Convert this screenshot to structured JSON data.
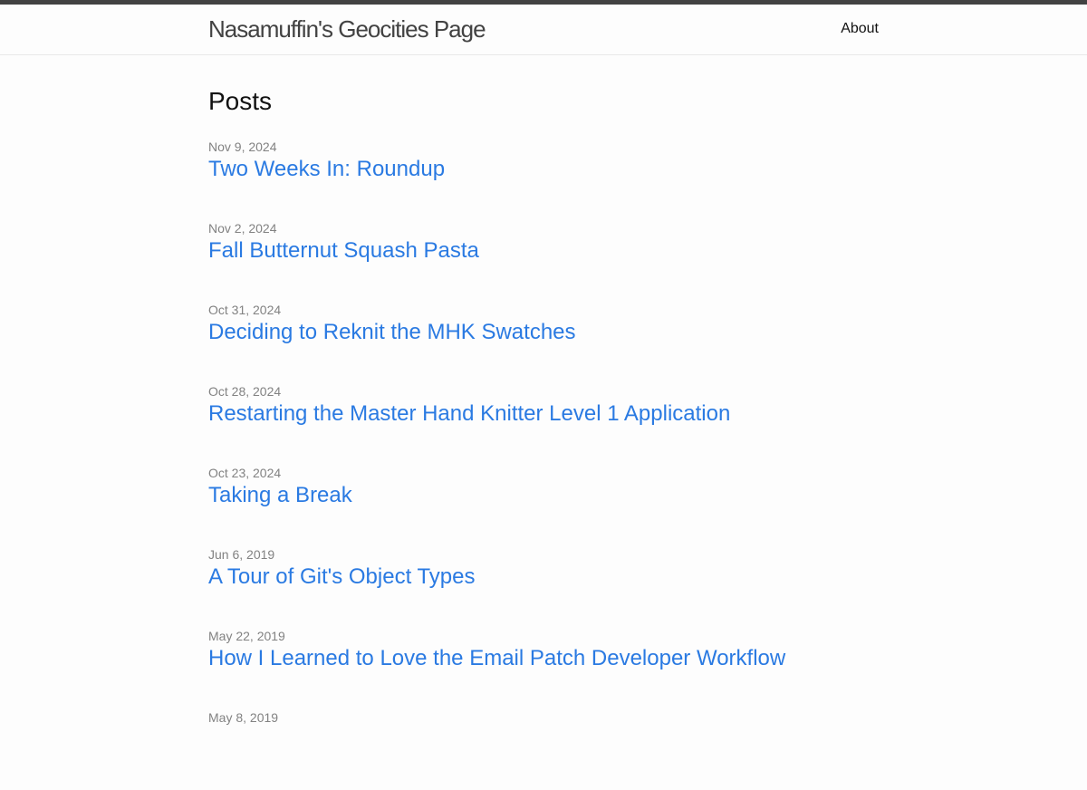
{
  "header": {
    "site_title": "Nasamuffin's Geocities Page",
    "nav": [
      {
        "label": "About"
      }
    ]
  },
  "main": {
    "heading": "Posts",
    "posts": [
      {
        "date": "Nov 9, 2024",
        "title": "Two Weeks In: Roundup"
      },
      {
        "date": "Nov 2, 2024",
        "title": "Fall Butternut Squash Pasta"
      },
      {
        "date": "Oct 31, 2024",
        "title": "Deciding to Reknit the MHK Swatches"
      },
      {
        "date": "Oct 28, 2024",
        "title": "Restarting the Master Hand Knitter Level 1 Application"
      },
      {
        "date": "Oct 23, 2024",
        "title": "Taking a Break"
      },
      {
        "date": "Jun 6, 2019",
        "title": "A Tour of Git's Object Types"
      },
      {
        "date": "May 22, 2019",
        "title": "How I Learned to Love the Email Patch Developer Workflow"
      },
      {
        "date": "May 8, 2019",
        "title": ""
      }
    ]
  },
  "colors": {
    "top_bar": "#424242",
    "link": "#2a7ae2",
    "meta": "#828282",
    "background": "#fdfdfd"
  }
}
